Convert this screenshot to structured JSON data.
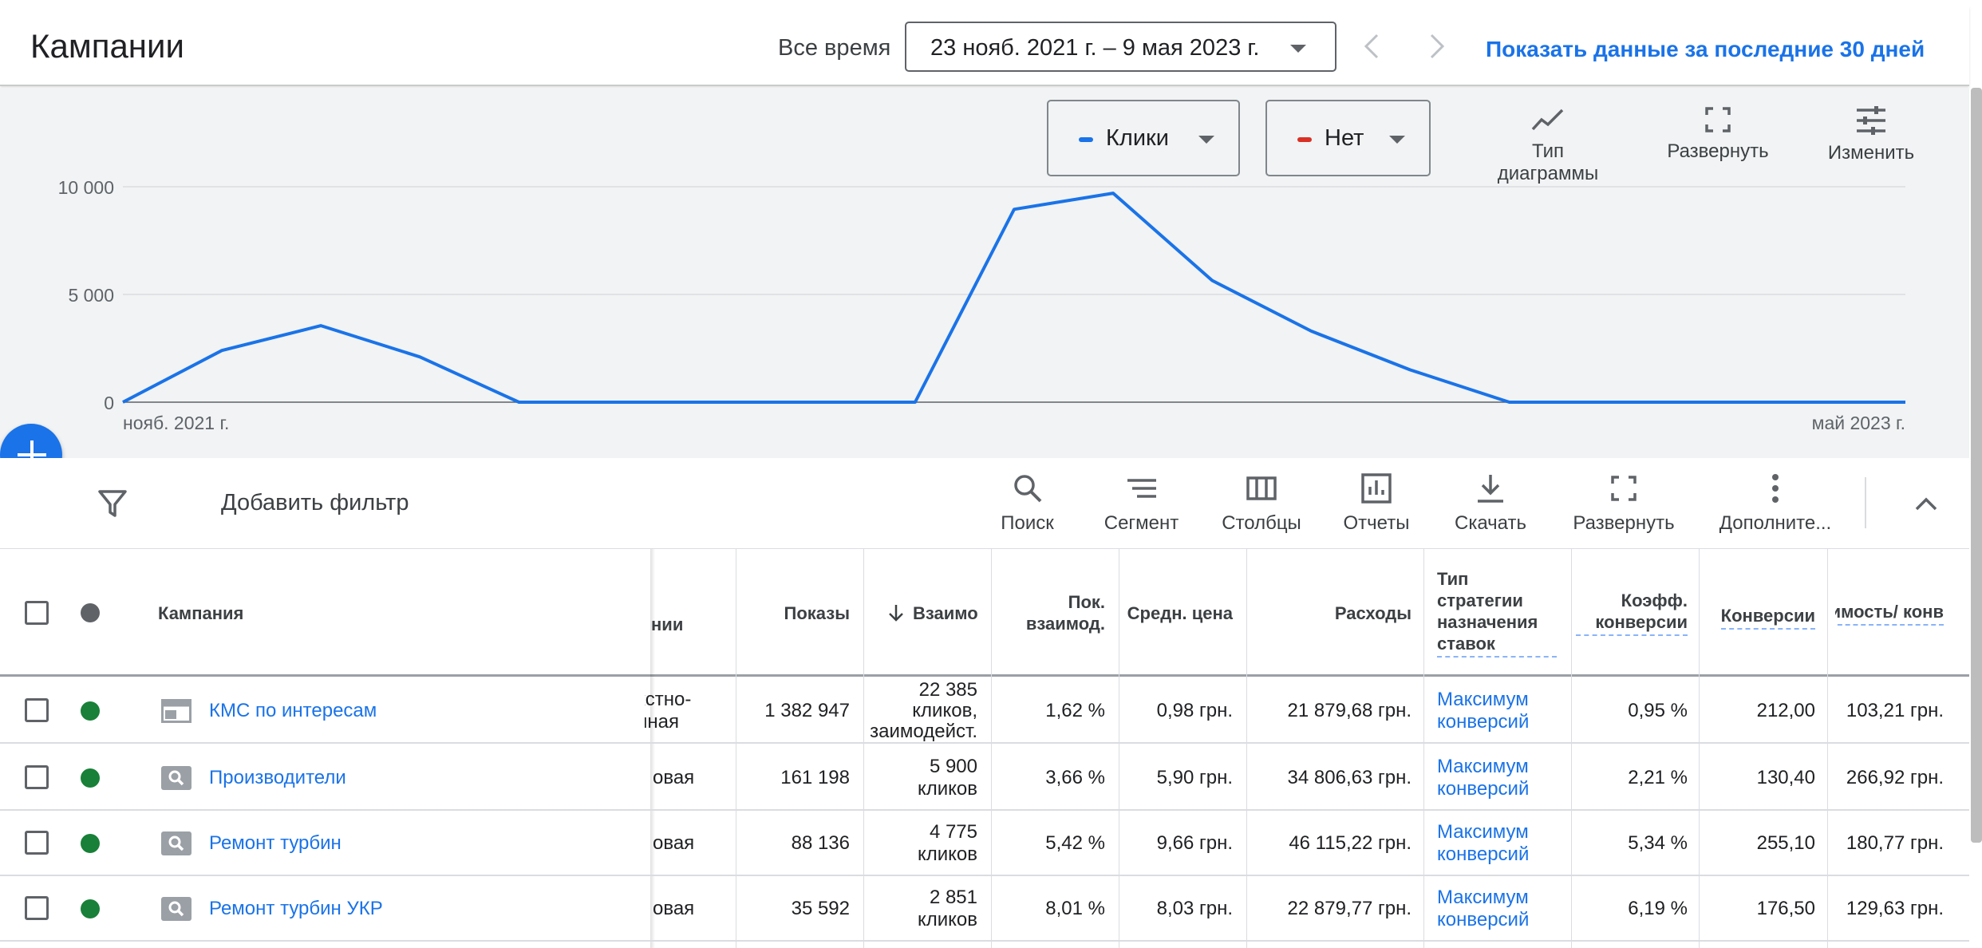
{
  "header": {
    "title": "Кампании",
    "period_label": "Все время",
    "date_range": "23 нояб. 2021 г. – 9 мая 2023 г.",
    "show_last_30": "Показать данные за последние 30 дней"
  },
  "chart_controls": {
    "metric1": "Клики",
    "metric1_color": "#1a73e8",
    "metric2": "Нет",
    "metric2_color": "#d93025",
    "chart_type": "Тип диаграммы",
    "expand": "Развернуть",
    "edit": "Изменить"
  },
  "chart_data": {
    "type": "line",
    "series": [
      {
        "name": "Клики",
        "color": "#1a73e8",
        "values": [
          0,
          2400,
          3550,
          2100,
          0,
          0,
          0,
          0,
          0,
          8950,
          9700,
          5650,
          3300,
          1500,
          0,
          0,
          0,
          0,
          0
        ]
      }
    ],
    "x_tick_labels": [
      "нояб. 2021 г.",
      "май 2023 г."
    ],
    "y_ticks": [
      "10 000",
      "5 000",
      "0"
    ],
    "ylim": [
      0,
      10000
    ],
    "grid": true
  },
  "toolbar": {
    "add_filter": "Добавить фильтр",
    "search": "Поиск",
    "segment": "Сегмент",
    "columns": "Столбцы",
    "reports": "Отчеты",
    "download": "Скачать",
    "expand": "Развернуть",
    "more": "Дополните..."
  },
  "table": {
    "headers": {
      "campaign": "Кампания",
      "type_partial": "нии",
      "impressions": "Показы",
      "interactions": "Взаимо",
      "interaction_rate": "Пок. взаимод.",
      "avg_cost": "Средн. цена",
      "cost": "Расходы",
      "bid_strategy": "Тип стратегии назначения ставок",
      "conv_rate": "Коэфф. конверсии",
      "conversions": "Конверсии",
      "cost_per_conv": "Стоимость/ конв"
    },
    "rows": [
      {
        "name": "КМС по интересам",
        "icon": "display-campaign-icon",
        "type_line1": "кстно-",
        "type_line2": "иная",
        "impressions": "1 382 947",
        "interactions_1": "22 385",
        "interactions_2": "кликов,",
        "interactions_3": "заимодейст.",
        "interaction_rate": "1,62 %",
        "avg_cost": "0,98 грн.",
        "cost": "21 879,68 грн.",
        "bid_1": "Максимум",
        "bid_2": "конверсий",
        "conv_rate": "0,95 %",
        "conversions": "212,00",
        "cost_per_conv": "103,21 грн."
      },
      {
        "name": "Производители",
        "icon": "search-campaign-icon",
        "type_line1": "овая",
        "type_line2": "",
        "impressions": "161 198",
        "interactions_1": "5 900",
        "interactions_2": "кликов",
        "interactions_3": "",
        "interaction_rate": "3,66 %",
        "avg_cost": "5,90 грн.",
        "cost": "34 806,63 грн.",
        "bid_1": "Максимум",
        "bid_2": "конверсий",
        "conv_rate": "2,21 %",
        "conversions": "130,40",
        "cost_per_conv": "266,92 грн."
      },
      {
        "name": "Ремонт турбин",
        "icon": "search-campaign-icon",
        "type_line1": "овая",
        "type_line2": "",
        "impressions": "88 136",
        "interactions_1": "4 775",
        "interactions_2": "кликов",
        "interactions_3": "",
        "interaction_rate": "5,42 %",
        "avg_cost": "9,66 грн.",
        "cost": "46 115,22 грн.",
        "bid_1": "Максимум",
        "bid_2": "конверсий",
        "conv_rate": "5,34 %",
        "conversions": "255,10",
        "cost_per_conv": "180,77 грн."
      },
      {
        "name": "Ремонт турбин УКР",
        "icon": "search-campaign-icon",
        "type_line1": "овая",
        "type_line2": "",
        "impressions": "35 592",
        "interactions_1": "2 851",
        "interactions_2": "кликов",
        "interactions_3": "",
        "interaction_rate": "8,01 %",
        "avg_cost": "8,03 грн.",
        "cost": "22 879,77 грн.",
        "bid_1": "Максимум",
        "bid_2": "конверсий",
        "conv_rate": "6,19 %",
        "conversions": "176,50",
        "cost_per_conv": "129,63 грн."
      }
    ]
  }
}
